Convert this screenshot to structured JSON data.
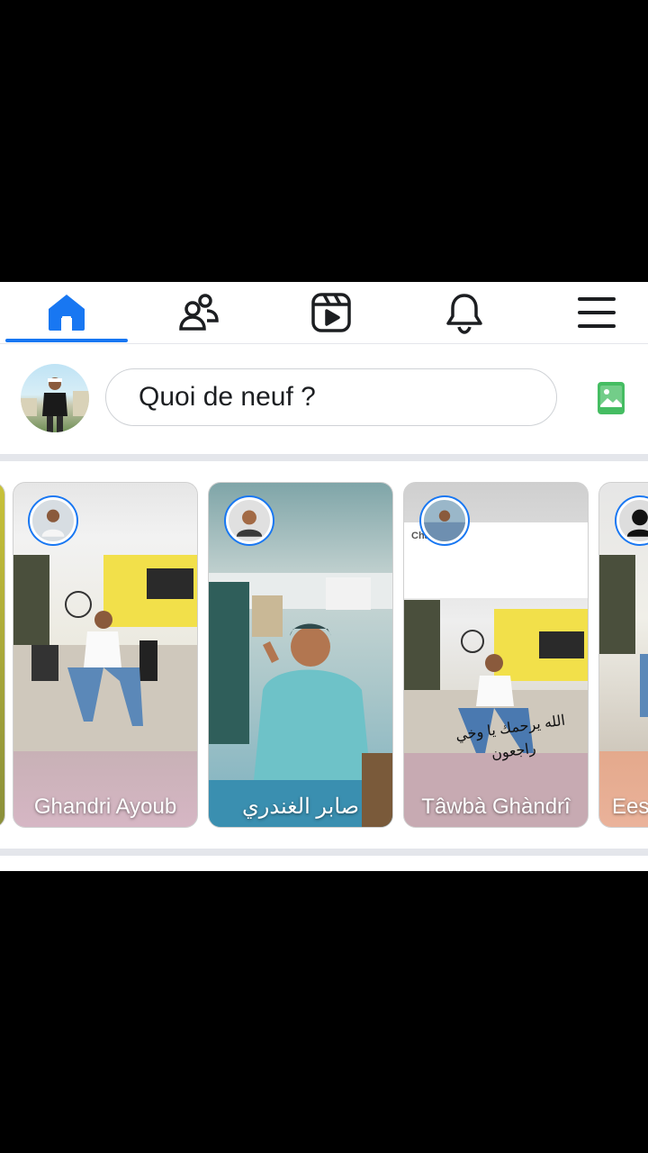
{
  "nav": {
    "items": [
      {
        "id": "home",
        "icon": "home-icon",
        "active": true
      },
      {
        "id": "friends",
        "icon": "friends-icon",
        "active": false
      },
      {
        "id": "video",
        "icon": "video-icon",
        "active": false
      },
      {
        "id": "notifications",
        "icon": "bell-icon",
        "active": false
      },
      {
        "id": "menu",
        "icon": "menu-icon",
        "active": false
      }
    ],
    "accent": "#1877f2"
  },
  "composer": {
    "placeholder": "Quoi de neuf ?",
    "photo_icon": "photo-icon"
  },
  "stories": [
    {
      "name": "Ghandri Ayoub"
    },
    {
      "name": "صابر الغندري"
    },
    {
      "name": "Tâwbà Ghàndrî",
      "header_name": "Chataoui",
      "overlay_text": "الله يرحمك يا وخي راجعون"
    },
    {
      "name": "Ees"
    }
  ],
  "colors": {
    "divider": "#e4e6eb",
    "photo_green": "#45bd62"
  }
}
